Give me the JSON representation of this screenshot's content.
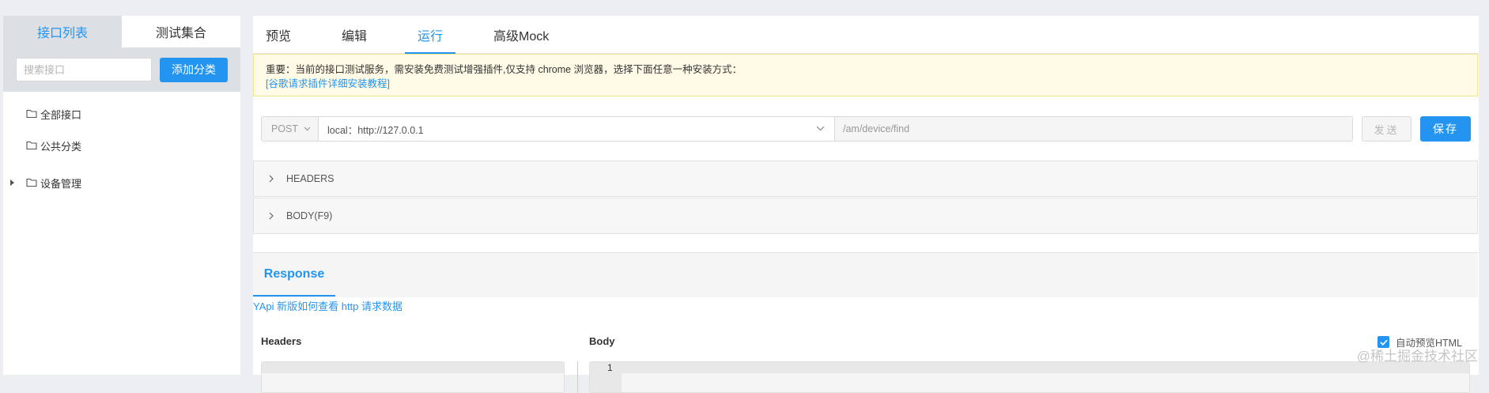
{
  "sidebar": {
    "tabs": [
      {
        "label": "接口列表",
        "active": true
      },
      {
        "label": "测试集合",
        "active": false
      }
    ],
    "search": {
      "placeholder": "搜索接口"
    },
    "add_category_label": "添加分类",
    "tree": [
      {
        "label": "全部接口",
        "expandable": false
      },
      {
        "label": "公共分类",
        "expandable": false
      },
      {
        "label": "设备管理",
        "expandable": true
      }
    ]
  },
  "main": {
    "tabs": [
      {
        "label": "预览",
        "active": false
      },
      {
        "label": "编辑",
        "active": false
      },
      {
        "label": "运行",
        "active": true
      },
      {
        "label": "高级Mock",
        "active": false
      }
    ],
    "notice": {
      "text": "重要：当前的接口测试服务，需安装免费测试增强插件,仅支持 chrome 浏览器，选择下面任意一种安装方式：",
      "link": "[谷歌请求插件详细安装教程]"
    },
    "request": {
      "method": "POST",
      "env": "local：http://127.0.0.1",
      "path": "/am/device/find",
      "send_label": "发送",
      "save_label": "保存"
    },
    "sections": [
      {
        "label": "HEADERS"
      },
      {
        "label": "BODY(F9)"
      }
    ],
    "response": {
      "tab_label": "Response",
      "help_link": "YApi 新版如何查看 http 请求数据",
      "headers_label": "Headers",
      "body_label": "Body",
      "auto_preview_label": "自动预览HTML",
      "auto_preview_checked": true,
      "line_number": "1"
    }
  },
  "watermark": "@稀土掘金技术社区",
  "colors": {
    "accent": "#2395f1",
    "notice_bg": "#fffbe6",
    "page_bg": "#eceef1"
  }
}
